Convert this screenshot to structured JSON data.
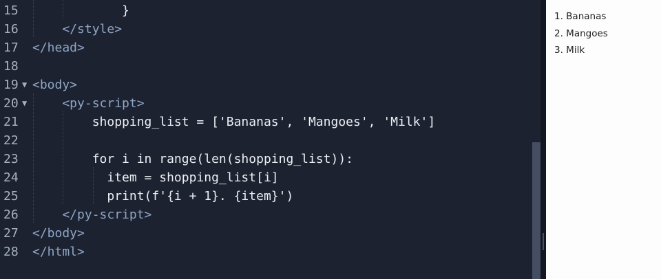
{
  "editor": {
    "lines": [
      {
        "number": "15",
        "text": "            }",
        "kind": "code"
      },
      {
        "number": "16",
        "text": "    </style>",
        "kind": "tag"
      },
      {
        "number": "17",
        "text": "</head>",
        "kind": "tag"
      },
      {
        "number": "18",
        "text": "",
        "kind": "code"
      },
      {
        "number": "19",
        "text": "<body>",
        "kind": "tag",
        "fold": "▼"
      },
      {
        "number": "20",
        "text": "    <py-script>",
        "kind": "tag",
        "fold": "▼"
      },
      {
        "number": "21",
        "text": "        shopping_list = ['Bananas', 'Mangoes', 'Milk']",
        "kind": "code"
      },
      {
        "number": "22",
        "text": "",
        "kind": "code"
      },
      {
        "number": "23",
        "text": "        for i in range(len(shopping_list)):",
        "kind": "code"
      },
      {
        "number": "24",
        "text": "          item = shopping_list[i]",
        "kind": "code"
      },
      {
        "number": "25",
        "text": "          print(f'{i + 1}. {item}')",
        "kind": "code"
      },
      {
        "number": "26",
        "text": "    </py-script>",
        "kind": "tag"
      },
      {
        "number": "27",
        "text": "</body>",
        "kind": "tag"
      },
      {
        "number": "28",
        "text": "</html>",
        "kind": "tag"
      }
    ]
  },
  "output": {
    "lines": [
      "1. Bananas",
      "2. Mangoes",
      "3. Milk"
    ]
  },
  "colors": {
    "editor_bg": "#1d2230",
    "tag": "#8ea6c6",
    "code": "#eceff4",
    "output_bg": "#fdfdfd"
  }
}
